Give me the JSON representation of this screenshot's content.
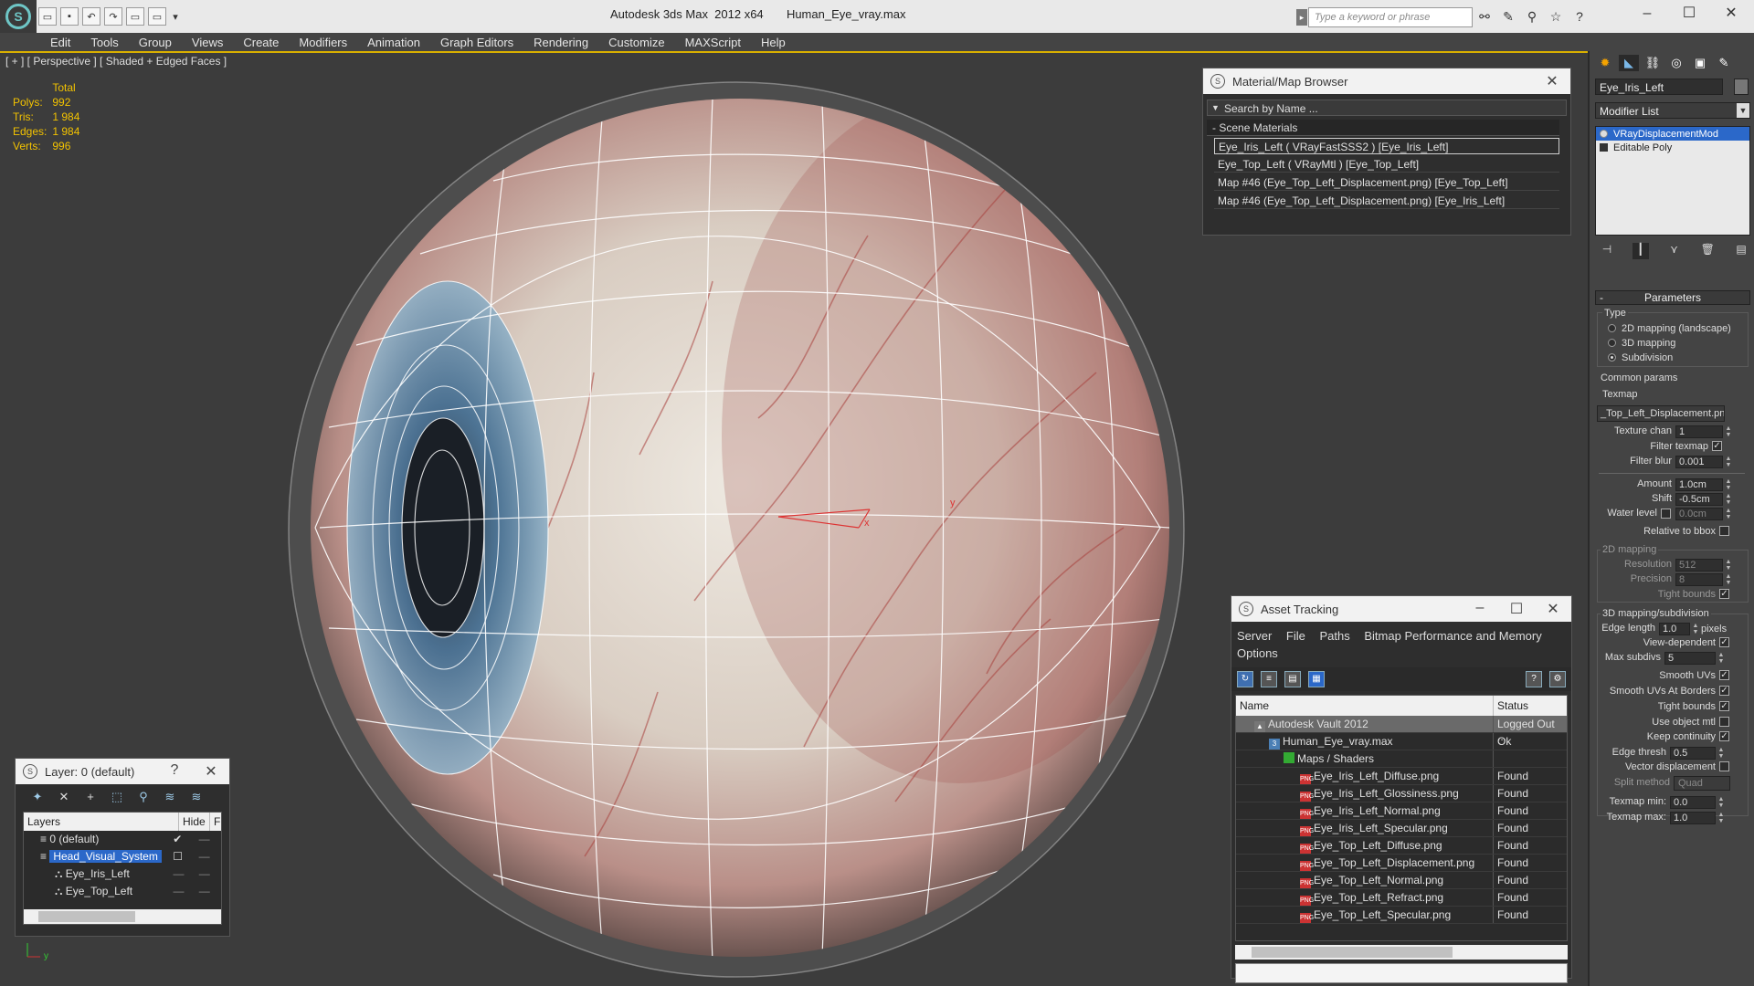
{
  "titlebar": {
    "title": "Autodesk 3ds Max  2012 x64       Human_Eye_vray.max",
    "search_placeholder": "Type a keyword or phrase"
  },
  "menu": [
    "Edit",
    "Tools",
    "Group",
    "Views",
    "Create",
    "Modifiers",
    "Animation",
    "Graph Editors",
    "Rendering",
    "Customize",
    "MAXScript",
    "Help"
  ],
  "viewport": {
    "label": "[ + ] [ Perspective ] [ Shaded + Edged Faces ]",
    "stats_header": "Total",
    "stats": [
      {
        "label": "Polys:",
        "value": "992"
      },
      {
        "label": "Tris:",
        "value": "1 984"
      },
      {
        "label": "Edges:",
        "value": "1 984"
      },
      {
        "label": "Verts:",
        "value": "996"
      }
    ],
    "gizmo_x": "x",
    "gizmo_y": "y"
  },
  "material_browser": {
    "title": "Material/Map Browser",
    "search": "Search by Name ...",
    "group": "Scene Materials",
    "items": [
      "Eye_Iris_Left  ( VRayFastSSS2 ) [Eye_Iris_Left]",
      "Eye_Top_Left  ( VRayMtl ) [Eye_Top_Left]",
      "Map #46 (Eye_Top_Left_Displacement.png) [Eye_Top_Left]",
      "Map #46 (Eye_Top_Left_Displacement.png) [Eye_Iris_Left]"
    ]
  },
  "asset_tracking": {
    "title": "Asset Tracking",
    "menu": [
      "Server",
      "File",
      "Paths",
      "Bitmap Performance and Memory",
      "Options"
    ],
    "columns": [
      "Name",
      "Status"
    ],
    "rows": [
      {
        "name": "Autodesk Vault 2012",
        "status": "Logged Out ...",
        "indent": 1,
        "icon": "vault"
      },
      {
        "name": "Human_Eye_vray.max",
        "status": "Ok",
        "indent": 2,
        "icon": "max"
      },
      {
        "name": "Maps / Shaders",
        "status": "",
        "indent": 3,
        "icon": "maps"
      },
      {
        "name": "Eye_Iris_Left_Diffuse.png",
        "status": "Found",
        "indent": 4,
        "icon": "png"
      },
      {
        "name": "Eye_Iris_Left_Glossiness.png",
        "status": "Found",
        "indent": 4,
        "icon": "png"
      },
      {
        "name": "Eye_Iris_Left_Normal.png",
        "status": "Found",
        "indent": 4,
        "icon": "png"
      },
      {
        "name": "Eye_Iris_Left_Specular.png",
        "status": "Found",
        "indent": 4,
        "icon": "png"
      },
      {
        "name": "Eye_Top_Left_Diffuse.png",
        "status": "Found",
        "indent": 4,
        "icon": "png"
      },
      {
        "name": "Eye_Top_Left_Displacement.png",
        "status": "Found",
        "indent": 4,
        "icon": "png"
      },
      {
        "name": "Eye_Top_Left_Normal.png",
        "status": "Found",
        "indent": 4,
        "icon": "png"
      },
      {
        "name": "Eye_Top_Left_Refract.png",
        "status": "Found",
        "indent": 4,
        "icon": "png"
      },
      {
        "name": "Eye_Top_Left_Specular.png",
        "status": "Found",
        "indent": 4,
        "icon": "png"
      }
    ]
  },
  "layers": {
    "title": "Layer: 0 (default)",
    "help": "?",
    "columns": [
      "Layers",
      "Hide",
      "F"
    ],
    "rows": [
      {
        "name": "0 (default)",
        "indent": 1,
        "selected": false,
        "active": true
      },
      {
        "name": "Head_Visual_System",
        "indent": 1,
        "selected": true,
        "active": false
      },
      {
        "name": "Eye_Iris_Left",
        "indent": 2,
        "selected": false,
        "active": false
      },
      {
        "name": "Eye_Top_Left",
        "indent": 2,
        "selected": false,
        "active": false
      }
    ]
  },
  "command_panel": {
    "object_name": "Eye_Iris_Left",
    "modifier_list": "Modifier List",
    "stack": [
      "VRayDisplacementMod",
      "Editable Poly"
    ],
    "params_title": "Parameters",
    "type_label": "Type",
    "type_options": [
      {
        "label": "2D mapping (landscape)",
        "on": false
      },
      {
        "label": "3D mapping",
        "on": false
      },
      {
        "label": "Subdivision",
        "on": true
      }
    ],
    "common_params": "Common params",
    "texmap_label": "Texmap",
    "texmap_value": "_Top_Left_Displacement.png)",
    "texture_chan_label": "Texture chan",
    "texture_chan": "1",
    "filter_texmap": "Filter texmap",
    "filter_blur_label": "Filter blur",
    "filter_blur": "0.001",
    "amount_label": "Amount",
    "amount": "1.0cm",
    "shift_label": "Shift",
    "shift": "-0.5cm",
    "water_level_label": "Water level",
    "water_level": "0.0cm",
    "relative_bbox": "Relative to bbox",
    "mapping2d": "2D mapping",
    "resolution_label": "Resolution",
    "resolution": "512",
    "precision_label": "Precision",
    "precision": "8",
    "tight_bounds": "Tight bounds",
    "mapping3d": "3D mapping/subdivision",
    "edge_length_label": "Edge length",
    "edge_length": "1.0",
    "pixels": "pixels",
    "view_dependent": "View-dependent",
    "max_subdivs_label": "Max subdivs",
    "max_subdivs": "5",
    "smooth_uvs": "Smooth UVs",
    "smooth_uvs_borders": "Smooth UVs At Borders",
    "tight_bounds2": "Tight bounds",
    "use_object_mtl": "Use object mtl",
    "keep_continuity": "Keep continuity",
    "edge_thresh_label": "Edge thresh",
    "edge_thresh": "0.5",
    "vector_disp": "Vector displacement",
    "split_method_label": "Split method",
    "split_method": "Quad",
    "texmap_min_label": "Texmap min:",
    "texmap_min": "0.0",
    "texmap_max_label": "Texmap max:",
    "texmap_max": "1.0"
  },
  "colors": {
    "viewport_bg": "#3c3c3c",
    "stats_yellow": "#f2c200",
    "selection_blue": "#2b68c9",
    "active_border": "#d9b000"
  }
}
